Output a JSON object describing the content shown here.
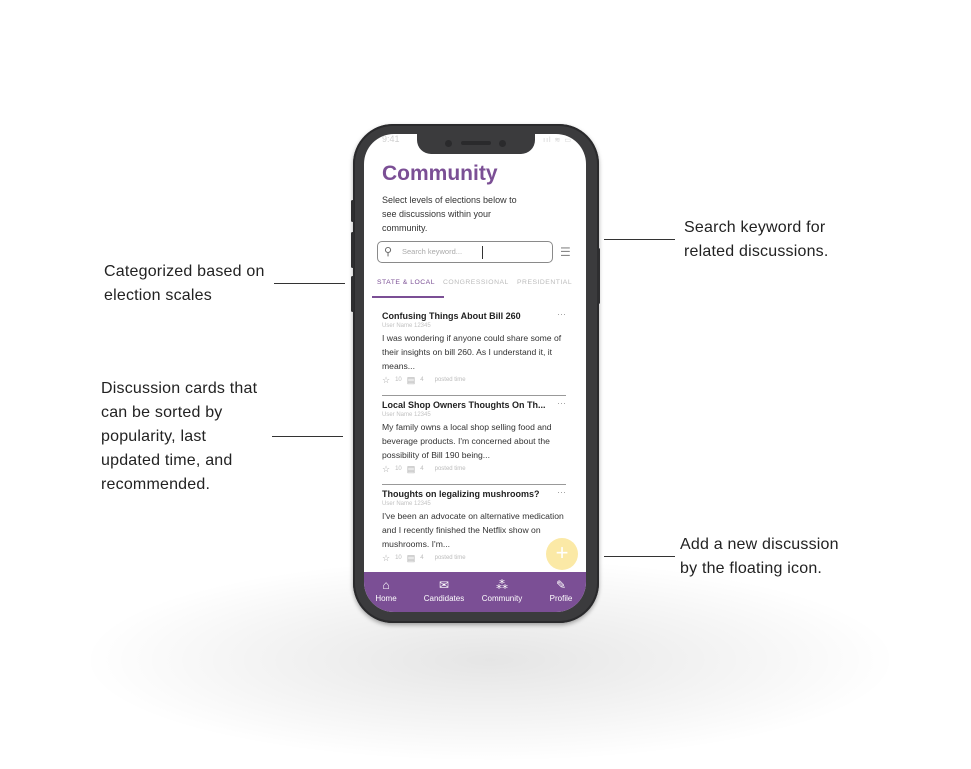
{
  "annotations": {
    "search": "Search keyword for\nrelated discussions.",
    "categories": "Categorized based on\nelection scales",
    "cards": "Discussion cards that\ncan be sorted by\npopularity, last\nupdated time, and\nrecommended.",
    "add": "Add a new discussion\nby the floating icon."
  },
  "phone": {
    "status_time": "9:41",
    "status_icons": "ııl ≋ ▭",
    "page_title": "Community",
    "subtitle": "Select levels of elections below to see discussions within your community.",
    "search_placeholder": "Search keyword...",
    "tabs": [
      "STATE & LOCAL",
      "CONGRESSIONAL",
      "PRESIDENTIAL"
    ],
    "active_tab": "STATE & LOCAL",
    "cards": [
      {
        "title": "Confusing Things About Bill 260",
        "user": "User Name 12345",
        "body": "I was wondering if anyone could share some of their insights on bill 260. As I understand it, it means...",
        "stars": "10",
        "comments": "4",
        "time": "posted time"
      },
      {
        "title": "Local Shop Owners Thoughts On Th...",
        "user": "User Name 12345",
        "body": "My family owns a local shop selling food and beverage products. I'm concerned about the possibility of Bill 190 being...",
        "stars": "10",
        "comments": "4",
        "time": "posted time"
      },
      {
        "title": "Thoughts on legalizing mushrooms?",
        "user": "User Name 12345",
        "body": "I've been an advocate on alternative medication and I recently finished the Netflix show on mushrooms. I'm...",
        "stars": "10",
        "comments": "4",
        "time": "posted time"
      }
    ],
    "more_icon": "···",
    "fab_label": "+",
    "nav": [
      {
        "label": "Home",
        "icon": "home-icon",
        "glyph": "⌂"
      },
      {
        "label": "Candidates",
        "icon": "ballot-icon",
        "glyph": "✉"
      },
      {
        "label": "Community",
        "icon": "people-icon",
        "glyph": "⁂"
      },
      {
        "label": "Profile",
        "icon": "profile-edit-icon",
        "glyph": "✎"
      }
    ]
  },
  "colors": {
    "accent": "#7b4f95",
    "fab": "#fbe9a6",
    "frame": "#3b3b3d"
  }
}
